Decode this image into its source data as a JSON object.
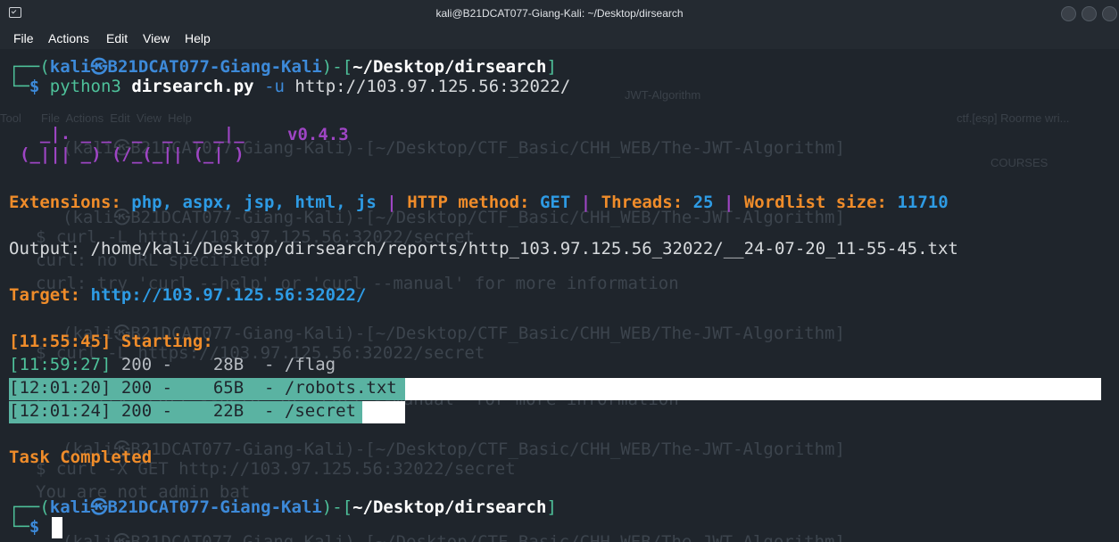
{
  "window": {
    "title": "kali@B21DCAT077-Giang-Kali: ~/Desktop/dirsearch"
  },
  "menu": {
    "file": "File",
    "actions": "Actions",
    "edit": "Edit",
    "view": "View",
    "help": "Help"
  },
  "prompt1": {
    "open": "┌──(",
    "user": "kali",
    "at": "㉿",
    "host": "B21DCAT077-Giang-Kali",
    "mid": ")-[",
    "path": "~/Desktop/dirsearch",
    "close": "]",
    "arrow": "└─",
    "dollar": "$",
    "cmd": "python3",
    "script": "dirsearch.py",
    "flag": "-u",
    "url": "http://103.97.125.56:32022/"
  },
  "banner": {
    "line1": "  _|. _ _  _  _  _ _|_",
    "line2": "(_||| _) (/_(_|| (_| )",
    "version": "v0.4.3"
  },
  "config": {
    "ext_label": "Extensions:",
    "ext_value": "php, aspx, jsp, html, js",
    "sep": "|",
    "method_label": "HTTP method:",
    "method_value": "GET",
    "threads_label": "Threads:",
    "threads_value": "25",
    "wordlist_label": "Wordlist size:",
    "wordlist_value": "11710"
  },
  "output": {
    "label": "Output:",
    "path": "/home/kali/Desktop/dirsearch/reports/http_103.97.125.56_32022/__24-07-20_11-55-45.txt"
  },
  "target": {
    "label": "Target:",
    "url": "http://103.97.125.56:32022/"
  },
  "starting": {
    "time": "[11:55:45]",
    "text": "Starting:"
  },
  "results": [
    {
      "time": "[11:59:27]",
      "code": "200",
      "size": "28B",
      "path": "/flag"
    },
    {
      "time": "[12:01:20]",
      "code": "200",
      "size": "65B",
      "path": "/robots.txt"
    },
    {
      "time": "[12:01:24]",
      "code": "200",
      "size": "22B",
      "path": "/secret"
    }
  ],
  "task": "Task Completed",
  "prompt2": {
    "open": "┌──(",
    "user": "kali",
    "at": "㉿",
    "host": "B21DCAT077-Giang-Kali",
    "mid": ")-[",
    "path": "~/Desktop/dirsearch",
    "close": "]",
    "arrow": "└─",
    "dollar": "$"
  },
  "ghost": {
    "g1": "$ curl -L http://103.97.125.56:32022/secret",
    "g2": "curl: no URL specified!",
    "g3": "curl: try 'curl --help' or 'curl --manual' for more information",
    "g4": "(kali㉿B21DCAT077-Giang-Kali)-[~/Desktop/CTF_Basic/CHH_WEB/The-JWT-Algorithm]",
    "g5": "$ curl -L https://103.97.125.56:32022/secret",
    "g6": "$ curl -X GET http://103.97.125.56:32022/secret",
    "g7": "You are not admin bat",
    "s1": "File  Actions  Edit  View  Help",
    "s2": "COURSES",
    "s3": "ctf.[esp] Roorme wri...",
    "s4": "JWT-Algorithm",
    "s5": "Tool"
  }
}
